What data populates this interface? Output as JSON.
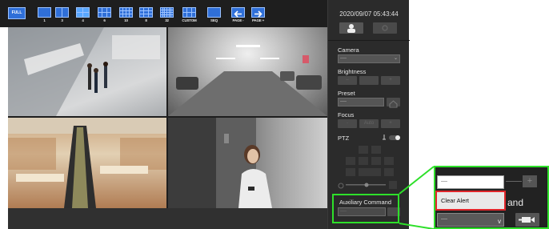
{
  "toolbar": {
    "full_label": "FULL",
    "layout_buttons": [
      {
        "label": "1",
        "cols": 1,
        "rows": 1
      },
      {
        "label": "3",
        "cols": 2,
        "rows": 1
      },
      {
        "label": "4",
        "cols": 2,
        "rows": 2,
        "active": true
      },
      {
        "label": "6",
        "cols": 3,
        "rows": 2
      },
      {
        "label": "10",
        "cols": 4,
        "rows": 3
      },
      {
        "label": "8",
        "cols": 3,
        "rows": 3
      },
      {
        "label": "32",
        "cols": 6,
        "rows": 4
      },
      {
        "label": "CUSTOM",
        "cols": 3,
        "rows": 2
      },
      {
        "label": "SEQ",
        "cols": 1,
        "rows": 1
      }
    ],
    "page_prev_label": "PAGE -",
    "page_next_label": "PAGE +"
  },
  "panel": {
    "datetime": "2020/09/07 05:43:44",
    "camera_label": "Camera",
    "camera_value": "----",
    "brightness_label": "Brightness",
    "preset_label": "Preset",
    "preset_value": "----",
    "focus_label": "Focus",
    "focus_buttons": [
      "-",
      "Auto",
      "+"
    ],
    "ptz_label": "PTZ",
    "auxiliary_label": "Auxiliary Command",
    "auxiliary_value": "----"
  },
  "zoom": {
    "input_value": "----",
    "menu_option": "Clear Alert",
    "cmd_fragment": "and",
    "select_value": "----",
    "plus_label": "+"
  },
  "colors": {
    "highlight": "#2ee02a",
    "menu_border": "#e0262b",
    "toolbar_bg": "#1e1e1e",
    "button_blue": "#2f6fd8"
  }
}
